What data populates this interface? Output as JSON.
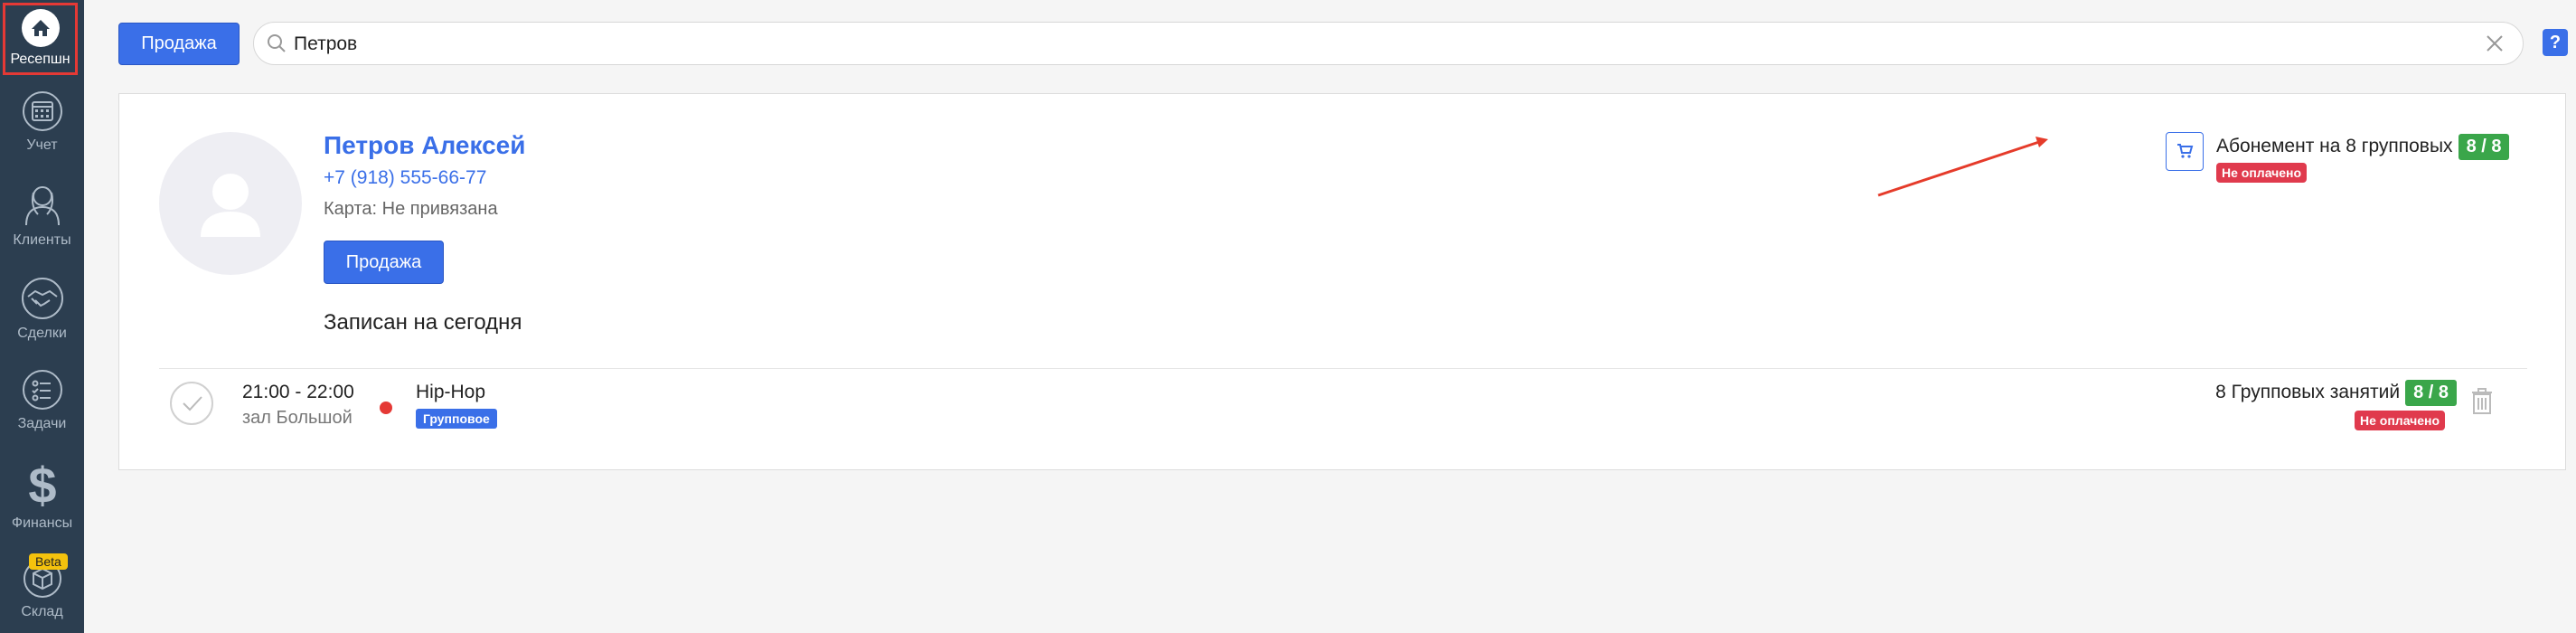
{
  "sidebar": {
    "items": [
      {
        "label": "Ресепшн",
        "icon": "home-icon",
        "active": true
      },
      {
        "label": "Учет",
        "icon": "calendar-icon"
      },
      {
        "label": "Клиенты",
        "icon": "clients-icon"
      },
      {
        "label": "Сделки",
        "icon": "handshake-icon"
      },
      {
        "label": "Задачи",
        "icon": "tasks-icon"
      },
      {
        "label": "Финансы",
        "icon": "dollar-icon"
      },
      {
        "label": "Склад",
        "icon": "box-icon",
        "badge": "Beta"
      }
    ]
  },
  "topbar": {
    "sale_label": "Продажа",
    "search_value": "Петров",
    "help_label": "?"
  },
  "client": {
    "name": "Петров Алексей",
    "phone": "+7 (918) 555-66-77",
    "card": "Карта: Не привязана",
    "sale_label": "Продажа",
    "booked_heading": "Записан на сегодня"
  },
  "subscription": {
    "title": "Абонемент на 8 групповых",
    "count": "8 / 8",
    "status": "Не оплачено"
  },
  "booking": {
    "time": "21:00 - 22:00",
    "hall": "зал Большой",
    "class_name": "Hip-Hop",
    "class_type": "Групповое",
    "lessons_title": "8 Групповых занятий",
    "lessons_count": "8 / 8",
    "status": "Не оплачено"
  },
  "colors": {
    "sidebar": "#2c3e50",
    "accent": "#3a6fe8",
    "success": "#3aa64a",
    "danger": "#e03a4d",
    "highlight": "#e53935",
    "beta": "#f4c20d"
  }
}
